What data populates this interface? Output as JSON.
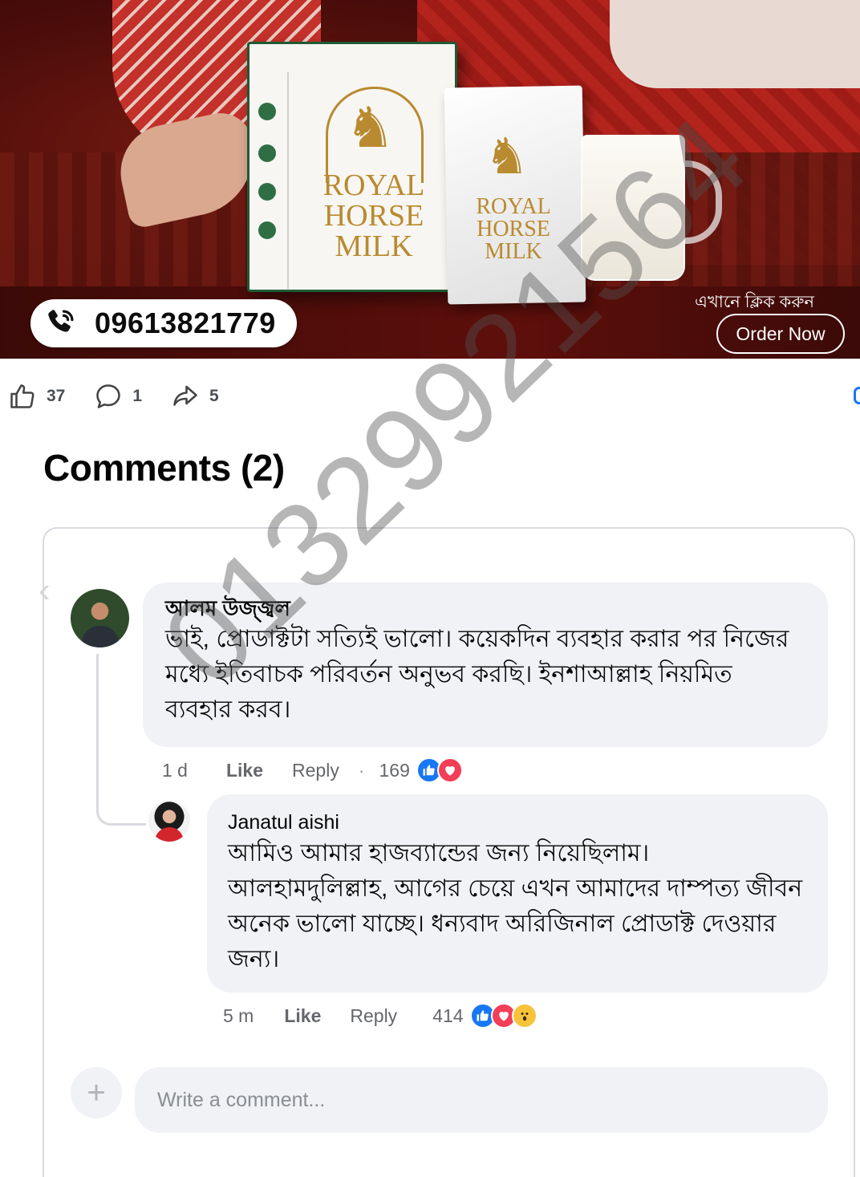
{
  "banner": {
    "brand_line1": "ROYAL",
    "brand_line2": "HORSE",
    "brand_line3": "MILK",
    "phone": "09613821779",
    "cta_text": "এখানে ক্লিক করুন",
    "order_button": "Order Now"
  },
  "stats": {
    "likes": "37",
    "comments": "1",
    "shares": "5"
  },
  "comments_header": "Comments (2)",
  "comments": [
    {
      "author": "আলম উজ্জ্বল",
      "text": "ভাই, প্রোডাক্টটা সত্যিই ভালো। কয়েকদিন ব্যবহার করার পর নিজের মধ্যে ইতিবাচক পরিবর্তন অনুভব করছি। ইনশাআল্লাহ নিয়মিত ব্যবহার করব।",
      "time": "1 d",
      "like_label": "Like",
      "reply_label": "Reply",
      "reaction_count": "169"
    },
    {
      "author": "Janatul aishi",
      "text": "আমিও আমার হাজব্যান্ডের জন্য নিয়েছিলাম। আলহামদুলিল্লাহ, আগের চেয়ে এখন আমাদের দাম্পত্য জীবন অনেক ভালো যাচ্ছে। ধন্যবাদ অরিজিনাল প্রোডাক্ট দেওয়ার জন্য।",
      "time": "5 m",
      "like_label": "Like",
      "reply_label": "Reply",
      "reaction_count": "414"
    }
  ],
  "composer": {
    "placeholder": "Write a comment..."
  },
  "watermark": "01329921564",
  "colors": {
    "like_blue": "#1877f2",
    "love_red": "#f33e58",
    "wow_yellow": "#f7c33a",
    "bubble_bg": "#f0f2f5",
    "brand_gold": "#b98a2f",
    "box_green": "#1f5a34"
  },
  "icons": [
    "phone-icon",
    "thumbs-up-icon",
    "comment-icon",
    "share-icon",
    "back-chevron-icon",
    "plus-icon",
    "like-reaction-icon",
    "love-reaction-icon",
    "wow-reaction-icon"
  ]
}
